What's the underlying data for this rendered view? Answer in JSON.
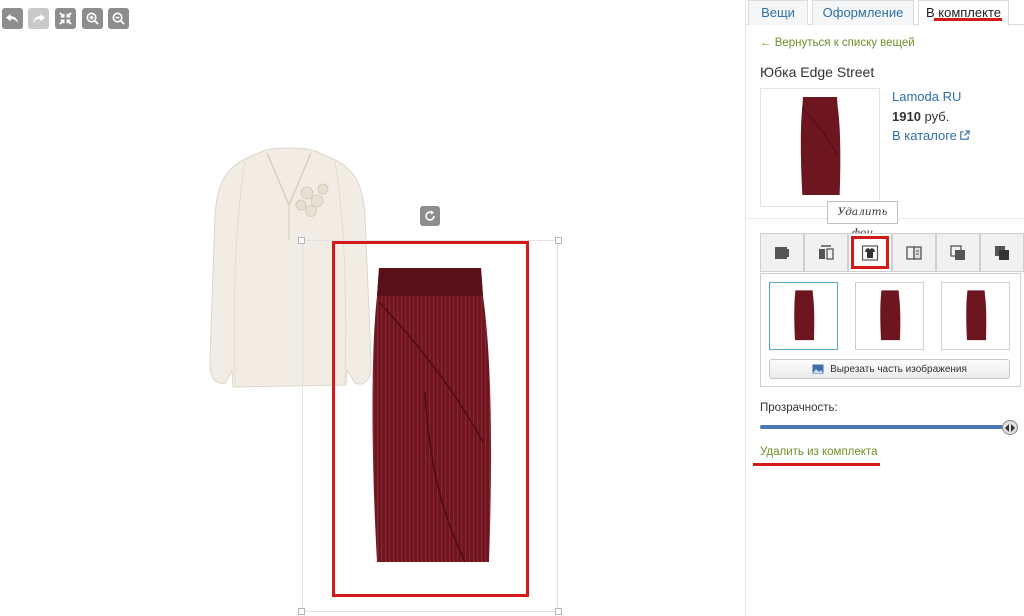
{
  "toolbar": {
    "undo_icon": "undo-icon",
    "redo_icon": "redo-icon",
    "fit_icon": "collapse-icon",
    "zoom_in_icon": "zoom-in-icon",
    "zoom_out_icon": "zoom-out-icon"
  },
  "tabs": [
    {
      "label": "Вещи"
    },
    {
      "label": "Оформление"
    },
    {
      "label": "В комплекте"
    }
  ],
  "back_link": "← Вернуться к списку вещей",
  "item": {
    "title": "Юбка Edge Street",
    "store": "Lamoda RU",
    "price_value": "1910",
    "price_unit": "руб.",
    "catalog_link": "В каталоге"
  },
  "tooltip": "Удалить фон",
  "crop_button": "Вырезать часть изображения",
  "opacity_label": "Прозрачность:",
  "opacity_value": 0.97,
  "remove_link": "Удалить из комплекта",
  "colors": {
    "skirt": "#6e1620",
    "highlight": "#d41919",
    "link": "#2f6fa5"
  }
}
